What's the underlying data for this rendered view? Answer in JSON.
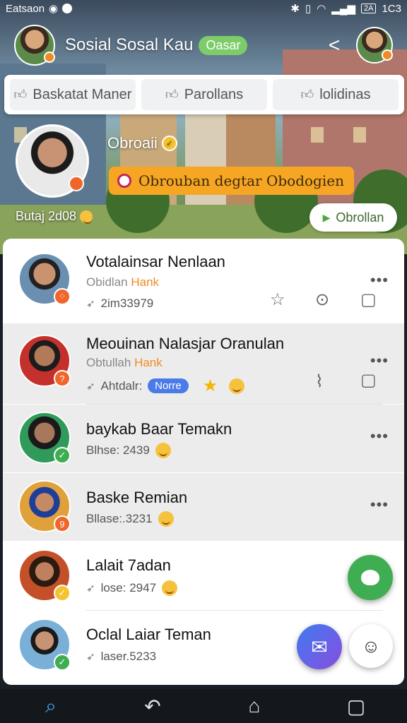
{
  "status_bar": {
    "carrier": "Eatsaon",
    "battery": "2A",
    "time": "1C3"
  },
  "header": {
    "title": "Sosial Sosal Kau",
    "chip": "Oasar"
  },
  "tabs": [
    {
      "label": "Baskatat Maner",
      "icon": "thumbs-up-icon"
    },
    {
      "label": "Parollans",
      "icon": "thumbs-up-icon"
    },
    {
      "label": "lolidinas",
      "icon": "thumbs-up-icon"
    }
  ],
  "profile": {
    "name": "Obroaii",
    "banner": "Obrouban degtar Obodogien",
    "stat": "Butaj 2d08",
    "chat_button": "Obrollan"
  },
  "contacts": [
    {
      "name": "Votalainsar Nenlaan",
      "sub_prefix": "Obidlan",
      "sub_highlight": "Hank",
      "meta": "2im33979",
      "badge_color": "#f0652a"
    },
    {
      "name": "Meouinan Nalasjar Oranulan",
      "sub_prefix": "Obtullah",
      "sub_highlight": "Hank",
      "meta": "Ahtdalr:",
      "pill": "Norre",
      "badge_color": "#f0652a"
    },
    {
      "name": "baykab Baar Temakn",
      "meta": "Blhse: 2439",
      "badge_color": "#3fae52"
    },
    {
      "name": "Baske Remian",
      "meta": "Bllase:.3231",
      "badge_color": "#f0652a"
    },
    {
      "name": "Lalait 7adan",
      "meta": "lose: 2947",
      "badge_color": "#f4c430"
    },
    {
      "name": "Oclal Laiar Teman",
      "meta": "laser.5233",
      "badge_color": "#3fae52"
    }
  ],
  "colors": {
    "accent_orange": "#f6a623",
    "accent_green": "#3fae52",
    "nav_active": "#3fa9f5"
  }
}
